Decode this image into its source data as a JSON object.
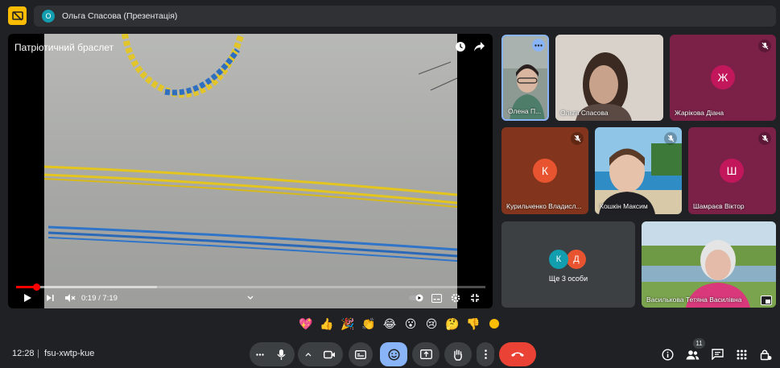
{
  "header": {
    "presenter_initial": "О",
    "presenter_label": "Ольга Спасова (Презентація)"
  },
  "video": {
    "title": "Патріотичний браслет",
    "time": "0:19 / 7:19",
    "progress_fraction": 0.044
  },
  "participants": [
    {
      "name": "Олена П...",
      "type": "video"
    },
    {
      "name": "Ольга Спасова",
      "type": "video"
    },
    {
      "name": "Жарікова Діана",
      "initial": "Ж",
      "muted": true
    },
    {
      "name": "Курильченко Владисл...",
      "initial": "К",
      "muted": true
    },
    {
      "name": "Кошкін Максим",
      "type": "video",
      "muted": true
    },
    {
      "name": "Шамраєв Віктор",
      "initial": "Ш",
      "muted": true
    },
    {
      "name": "Василькова Тетяна Василівна",
      "type": "video"
    }
  ],
  "others": {
    "initials": [
      "К",
      "Д"
    ],
    "label": "Ще 3 особи"
  },
  "reactions": [
    "💖",
    "👍",
    "🎉",
    "👏",
    "😂",
    "😮",
    "😢",
    "🤔",
    "👎"
  ],
  "footer": {
    "time": "12:28",
    "separator": "|",
    "meeting_code": "fsu-xwtp-kue",
    "people_count": "11"
  },
  "colors": {
    "background": "#202124",
    "end_call": "#ea4335",
    "reaction_active": "#8ab4f8",
    "avatar_pink": "#b0235f",
    "avatar_orange": "#e8542f",
    "avatar_teal": "#129eaf"
  }
}
